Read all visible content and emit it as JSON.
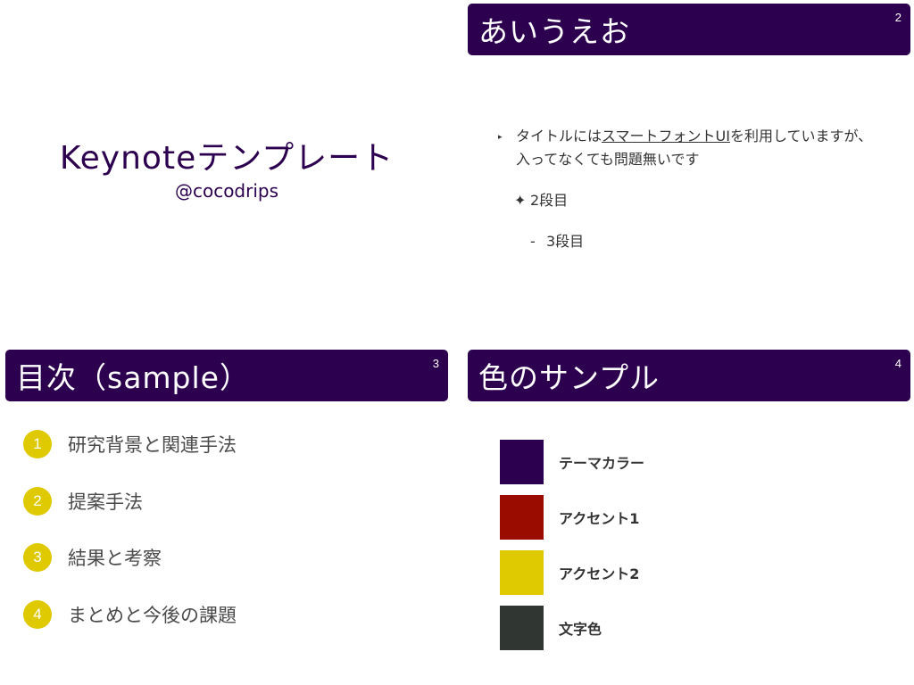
{
  "colors": {
    "theme": "#2c004f",
    "accent1": "#9b0c00",
    "accent2": "#dfc900",
    "text": "#303631"
  },
  "slides": [
    {
      "number": "",
      "title": "Keynoteテンプレート",
      "author": "@cocodrips"
    },
    {
      "number": "2",
      "title": "あいうえお",
      "bullets": {
        "l1_prefix": "タイトルには",
        "l1_link": "スマートフォントUI",
        "l1_suffix": "を利用していますが、入ってなくても問題無いです",
        "l1_marker": "▸",
        "l2_marker": "✦",
        "l2_text": "2段目",
        "l3_marker": "-",
        "l3_text": "3段目"
      }
    },
    {
      "number": "3",
      "title": "目次（sample）",
      "items": [
        {
          "num": "1",
          "label": "研究背景と関連手法"
        },
        {
          "num": "2",
          "label": "提案手法"
        },
        {
          "num": "3",
          "label": "結果と考察"
        },
        {
          "num": "4",
          "label": "まとめと今後の課題"
        }
      ]
    },
    {
      "number": "4",
      "title": "色のサンプル",
      "swatches": [
        {
          "label": "テーマカラー",
          "color": "#2c004f"
        },
        {
          "label": "アクセント1",
          "color": "#9b0c00"
        },
        {
          "label": "アクセント2",
          "color": "#dfc900"
        },
        {
          "label": "文字色",
          "color": "#303631"
        }
      ]
    }
  ]
}
